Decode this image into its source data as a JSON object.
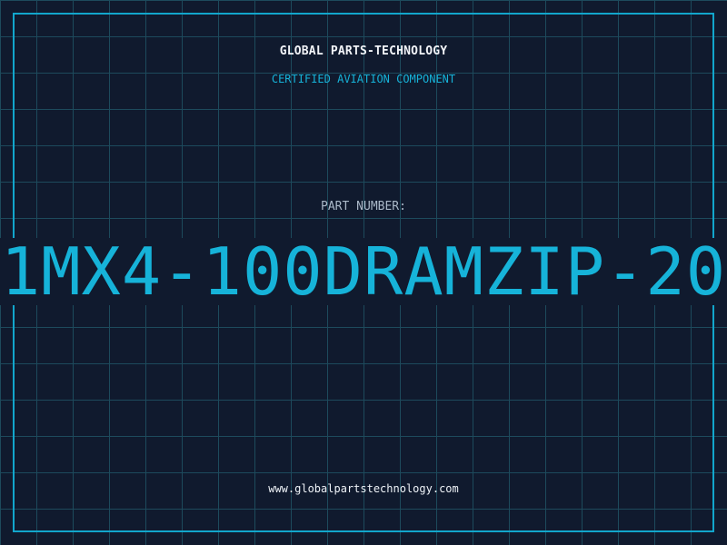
{
  "header": {
    "company": "GLOBAL PARTS-TECHNOLOGY",
    "tagline": "CERTIFIED AVIATION COMPONENT"
  },
  "part": {
    "label": "PART NUMBER:",
    "number": "1MX4-100DRAMZIP-20"
  },
  "footer": {
    "website": "www.globalpartstechnology.com"
  },
  "colors": {
    "background": "#101a2e",
    "grid": "#1d4a5c",
    "accent": "#16b3d9",
    "text": "#f2f4f8",
    "muted": "#aab8c8"
  }
}
